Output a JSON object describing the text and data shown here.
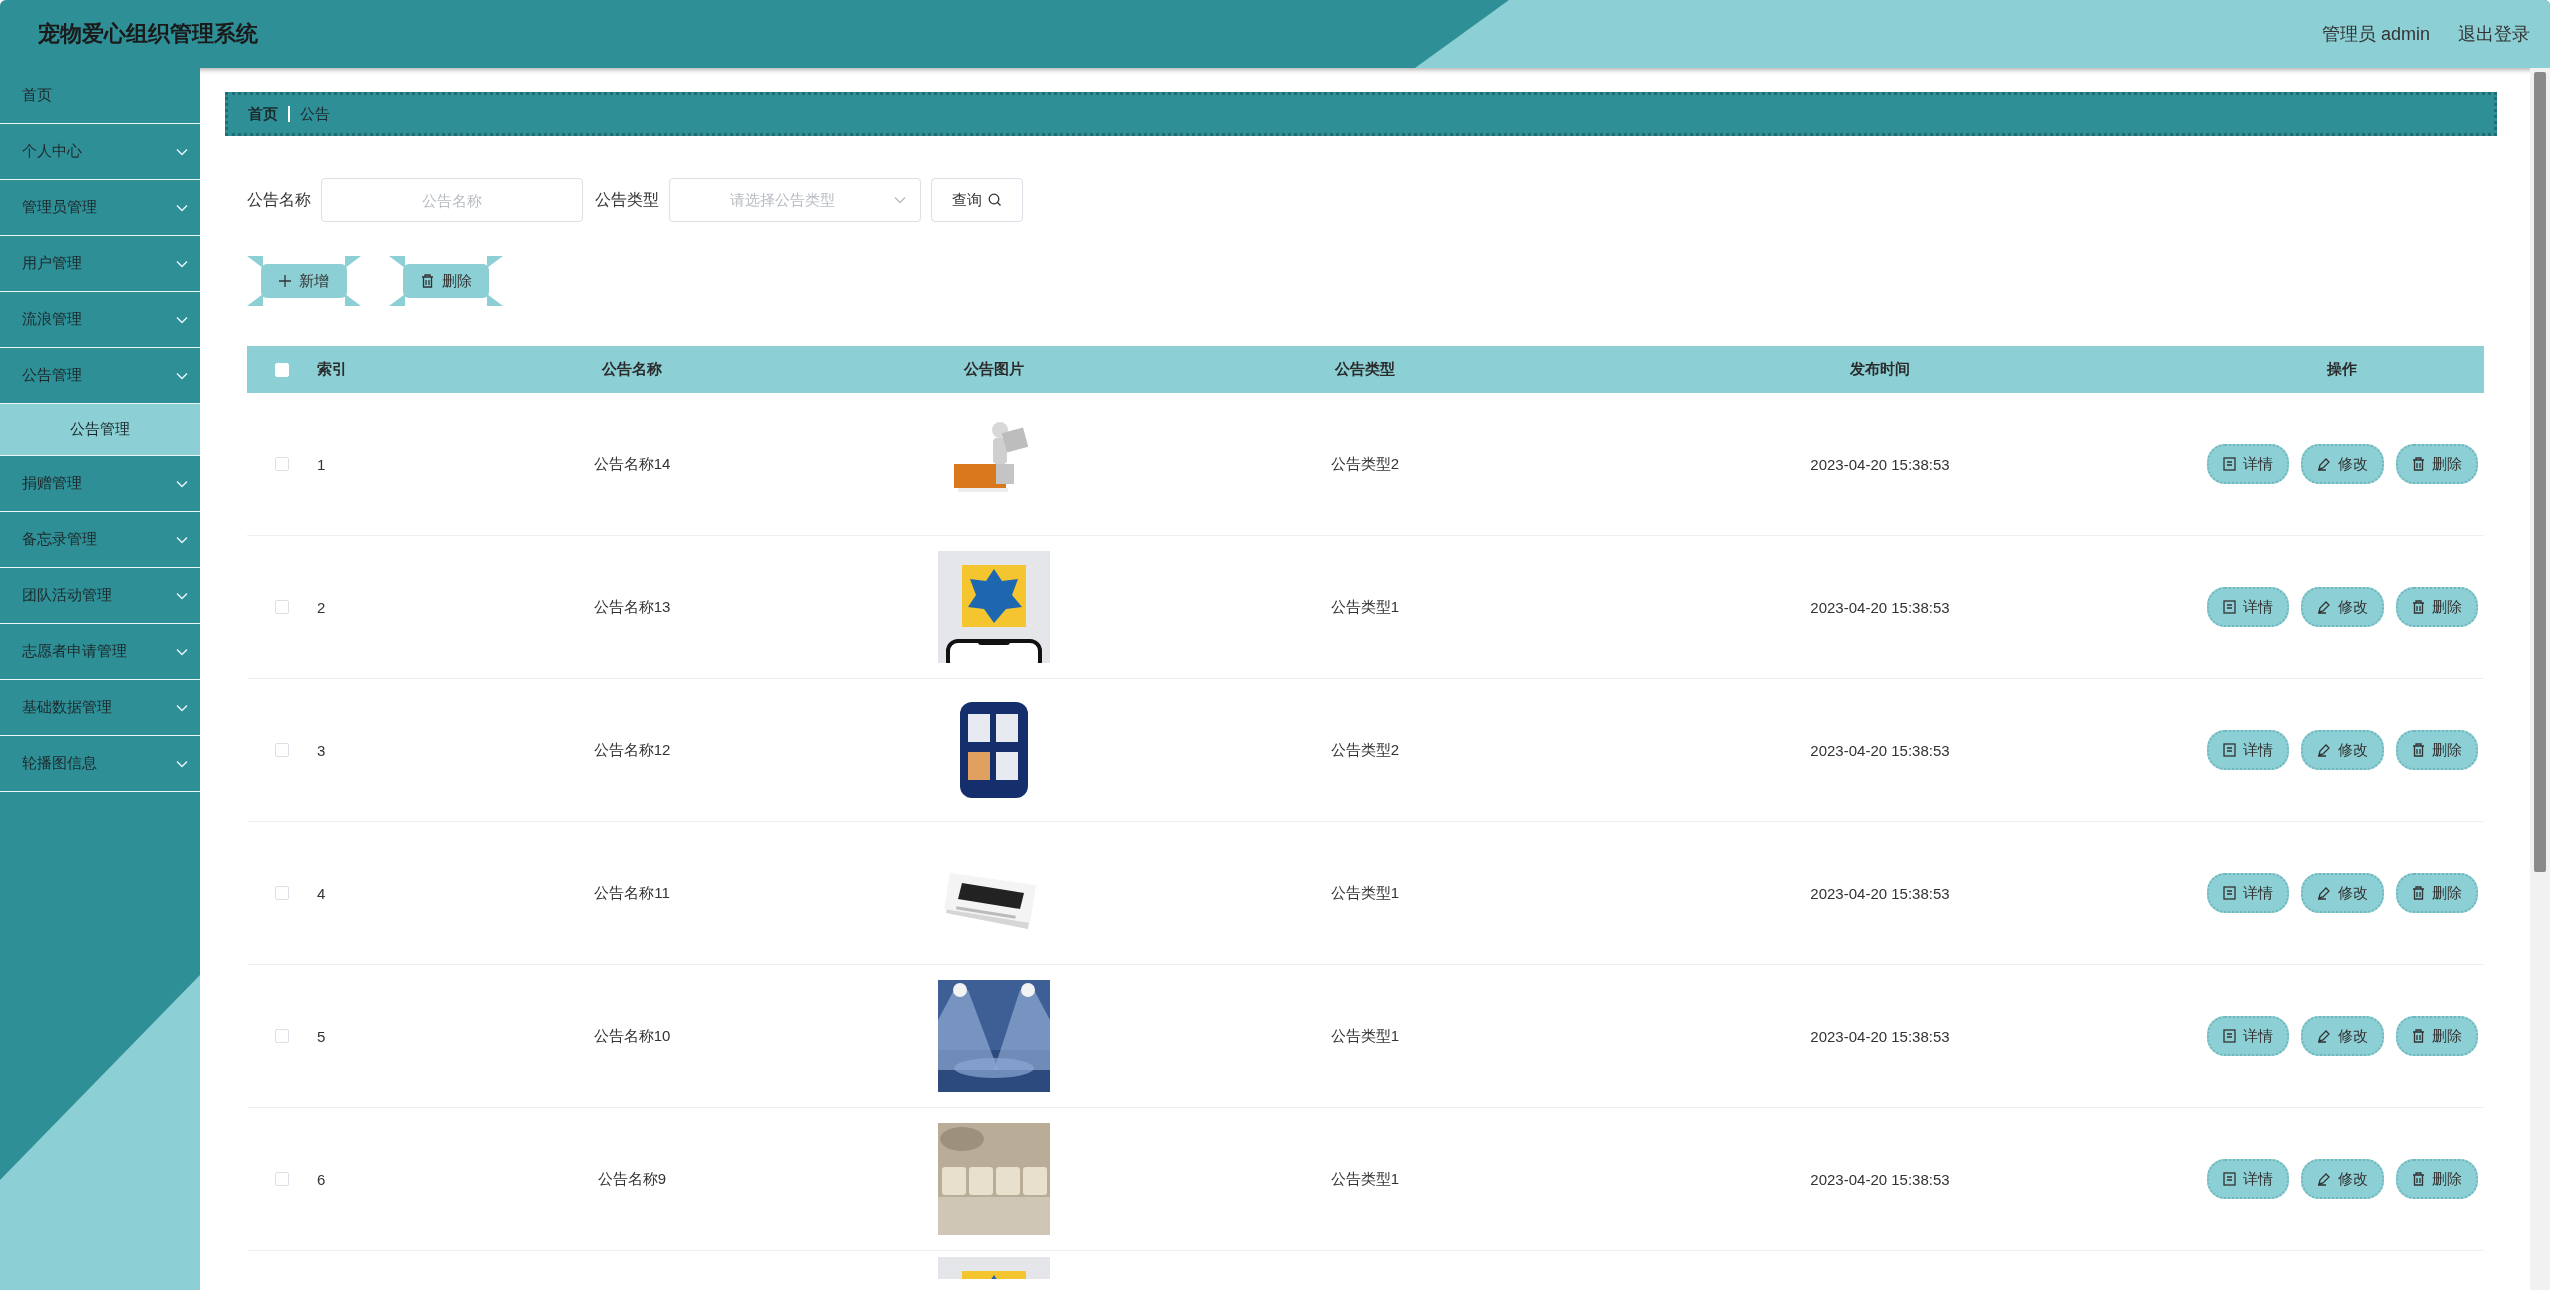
{
  "header": {
    "title": "宠物爱心组织管理系统",
    "user": "管理员 admin",
    "logout": "退出登录"
  },
  "sidebar": {
    "items": [
      {
        "kind": "link",
        "label": "首页"
      },
      {
        "kind": "menu",
        "label": "个人中心"
      },
      {
        "kind": "menu",
        "label": "管理员管理"
      },
      {
        "kind": "menu",
        "label": "用户管理"
      },
      {
        "kind": "menu",
        "label": "流浪管理"
      },
      {
        "kind": "menu",
        "label": "公告管理",
        "children": [
          {
            "label": "公告管理",
            "selected": true
          }
        ]
      },
      {
        "kind": "menu",
        "label": "捐赠管理"
      },
      {
        "kind": "menu",
        "label": "备忘录管理"
      },
      {
        "kind": "menu",
        "label": "团队活动管理"
      },
      {
        "kind": "menu",
        "label": "志愿者申请管理"
      },
      {
        "kind": "menu",
        "label": "基础数据管理"
      },
      {
        "kind": "menu",
        "label": "轮播图信息"
      }
    ]
  },
  "breadcrumb": [
    "首页",
    "公告"
  ],
  "search": {
    "fields": [
      {
        "kind": "text",
        "label": "公告名称",
        "placeholder": "公告名称"
      },
      {
        "kind": "select",
        "label": "公告类型",
        "placeholder": "请选择公告类型"
      }
    ],
    "button": "查询"
  },
  "actions": [
    {
      "kind": "add",
      "label": "新增"
    },
    {
      "kind": "delete",
      "label": "删除"
    }
  ],
  "table": {
    "select_all": {
      "checked": false
    },
    "columns": [
      "索引",
      "公告名称",
      "公告图片",
      "公告类型",
      "发布时间",
      "操作"
    ],
    "rows": [
      {
        "checked": false,
        "index": "1",
        "name": "公告名称14",
        "image": {
          "kind": "picture"
        },
        "type": "公告类型2",
        "time": "2023-04-20 15:38:53",
        "actions": [
          {
            "kind": "detail",
            "label": "详情"
          },
          {
            "kind": "edit",
            "label": "修改"
          },
          {
            "kind": "delete",
            "label": "删除"
          }
        ]
      },
      {
        "checked": false,
        "index": "2",
        "name": "公告名称13",
        "image": {
          "kind": "picture"
        },
        "type": "公告类型1",
        "time": "2023-04-20 15:38:53",
        "actions": [
          {
            "kind": "detail",
            "label": "详情"
          },
          {
            "kind": "edit",
            "label": "修改"
          },
          {
            "kind": "delete",
            "label": "删除"
          }
        ]
      },
      {
        "checked": false,
        "index": "3",
        "name": "公告名称12",
        "image": {
          "kind": "picture"
        },
        "type": "公告类型2",
        "time": "2023-04-20 15:38:53",
        "actions": [
          {
            "kind": "detail",
            "label": "详情"
          },
          {
            "kind": "edit",
            "label": "修改"
          },
          {
            "kind": "delete",
            "label": "删除"
          }
        ]
      },
      {
        "checked": false,
        "index": "4",
        "name": "公告名称11",
        "image": {
          "kind": "picture"
        },
        "type": "公告类型1",
        "time": "2023-04-20 15:38:53",
        "actions": [
          {
            "kind": "detail",
            "label": "详情"
          },
          {
            "kind": "edit",
            "label": "修改"
          },
          {
            "kind": "delete",
            "label": "删除"
          }
        ]
      },
      {
        "checked": false,
        "index": "5",
        "name": "公告名称10",
        "image": {
          "kind": "picture"
        },
        "type": "公告类型1",
        "time": "2023-04-20 15:38:53",
        "actions": [
          {
            "kind": "detail",
            "label": "详情"
          },
          {
            "kind": "edit",
            "label": "修改"
          },
          {
            "kind": "delete",
            "label": "删除"
          }
        ]
      },
      {
        "checked": false,
        "index": "6",
        "name": "公告名称9",
        "image": {
          "kind": "picture"
        },
        "type": "公告类型1",
        "time": "2023-04-20 15:38:53",
        "actions": [
          {
            "kind": "detail",
            "label": "详情"
          },
          {
            "kind": "edit",
            "label": "修改"
          },
          {
            "kind": "delete",
            "label": "删除"
          }
        ]
      },
      {
        "image": {
          "kind": "picture"
        }
      }
    ]
  }
}
